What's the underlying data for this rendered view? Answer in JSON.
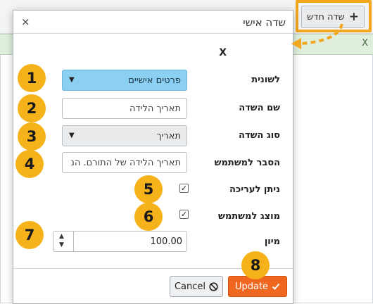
{
  "background": {
    "new_field_button": "שדה חדש",
    "alert_close": "X"
  },
  "dialog": {
    "title": "שדה אישי",
    "close": "×",
    "section_label": "X",
    "rows": {
      "tab": {
        "label": "לשונית",
        "value": "פרטים אישיים"
      },
      "field_name": {
        "label": "שם השדה",
        "value": "תאריך הלידה"
      },
      "field_type": {
        "label": "סוג השדה",
        "value": "תאריך"
      },
      "user_explanation": {
        "label": "הסבר למשתמש",
        "value": "תאריך הלידה של התורם. הנ"
      },
      "editable": {
        "label": "ניתן לעריכה",
        "checked": true
      },
      "shown_to_user": {
        "label": "מוצג למשתמש",
        "checked": true
      },
      "sort": {
        "label": "מיון",
        "value": "100.00"
      }
    },
    "buttons": {
      "cancel": "Cancel",
      "update": "Update"
    }
  },
  "callouts": [
    "1",
    "2",
    "3",
    "4",
    "5",
    "6",
    "7",
    "8"
  ],
  "colors": {
    "callout": "#f6b21a",
    "highlight": "#f2a71e",
    "update_button": "#f0671f",
    "tab_select": "#8bd0f3"
  }
}
